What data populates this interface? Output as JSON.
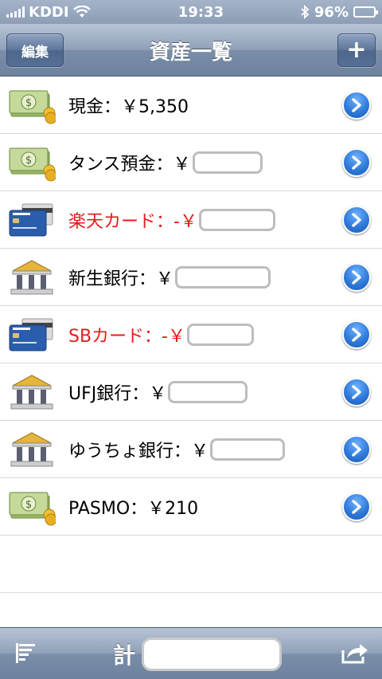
{
  "status_bar": {
    "carrier": "KDDI",
    "time": "19:33",
    "battery": "96%",
    "battery_level": 0.96
  },
  "nav": {
    "edit_label": "編集",
    "title": "資産一覧",
    "add_label": "+"
  },
  "assets": [
    {
      "icon": "cash-icon",
      "label": "現金：￥5,350",
      "redacted": false
    },
    {
      "icon": "cash-icon",
      "label": "タンス預金：￥",
      "redacted": true,
      "negative": false
    },
    {
      "icon": "credit-card-icon",
      "label": "楽天カード：-￥",
      "redacted": true,
      "negative": true
    },
    {
      "icon": "bank-icon",
      "label": "新生銀行：￥",
      "redacted": true,
      "negative": false
    },
    {
      "icon": "credit-card-icon",
      "label": "SBカード：-￥",
      "redacted": true,
      "negative": true
    },
    {
      "icon": "bank-icon",
      "label": "UFJ銀行：￥",
      "redacted": true,
      "negative": false
    },
    {
      "icon": "bank-icon",
      "label": "ゆうちょ銀行：￥",
      "redacted": true,
      "negative": false
    },
    {
      "icon": "cash-icon",
      "label": "PASMO：￥210",
      "redacted": false
    }
  ],
  "toolbar": {
    "total_label": "計",
    "left_icon": "sort-list-icon",
    "right_icon": "share-icon"
  },
  "colors": {
    "negative": "#e51b1b",
    "bar": "#7a8ea9",
    "disclosure": "#2f7ad9"
  }
}
